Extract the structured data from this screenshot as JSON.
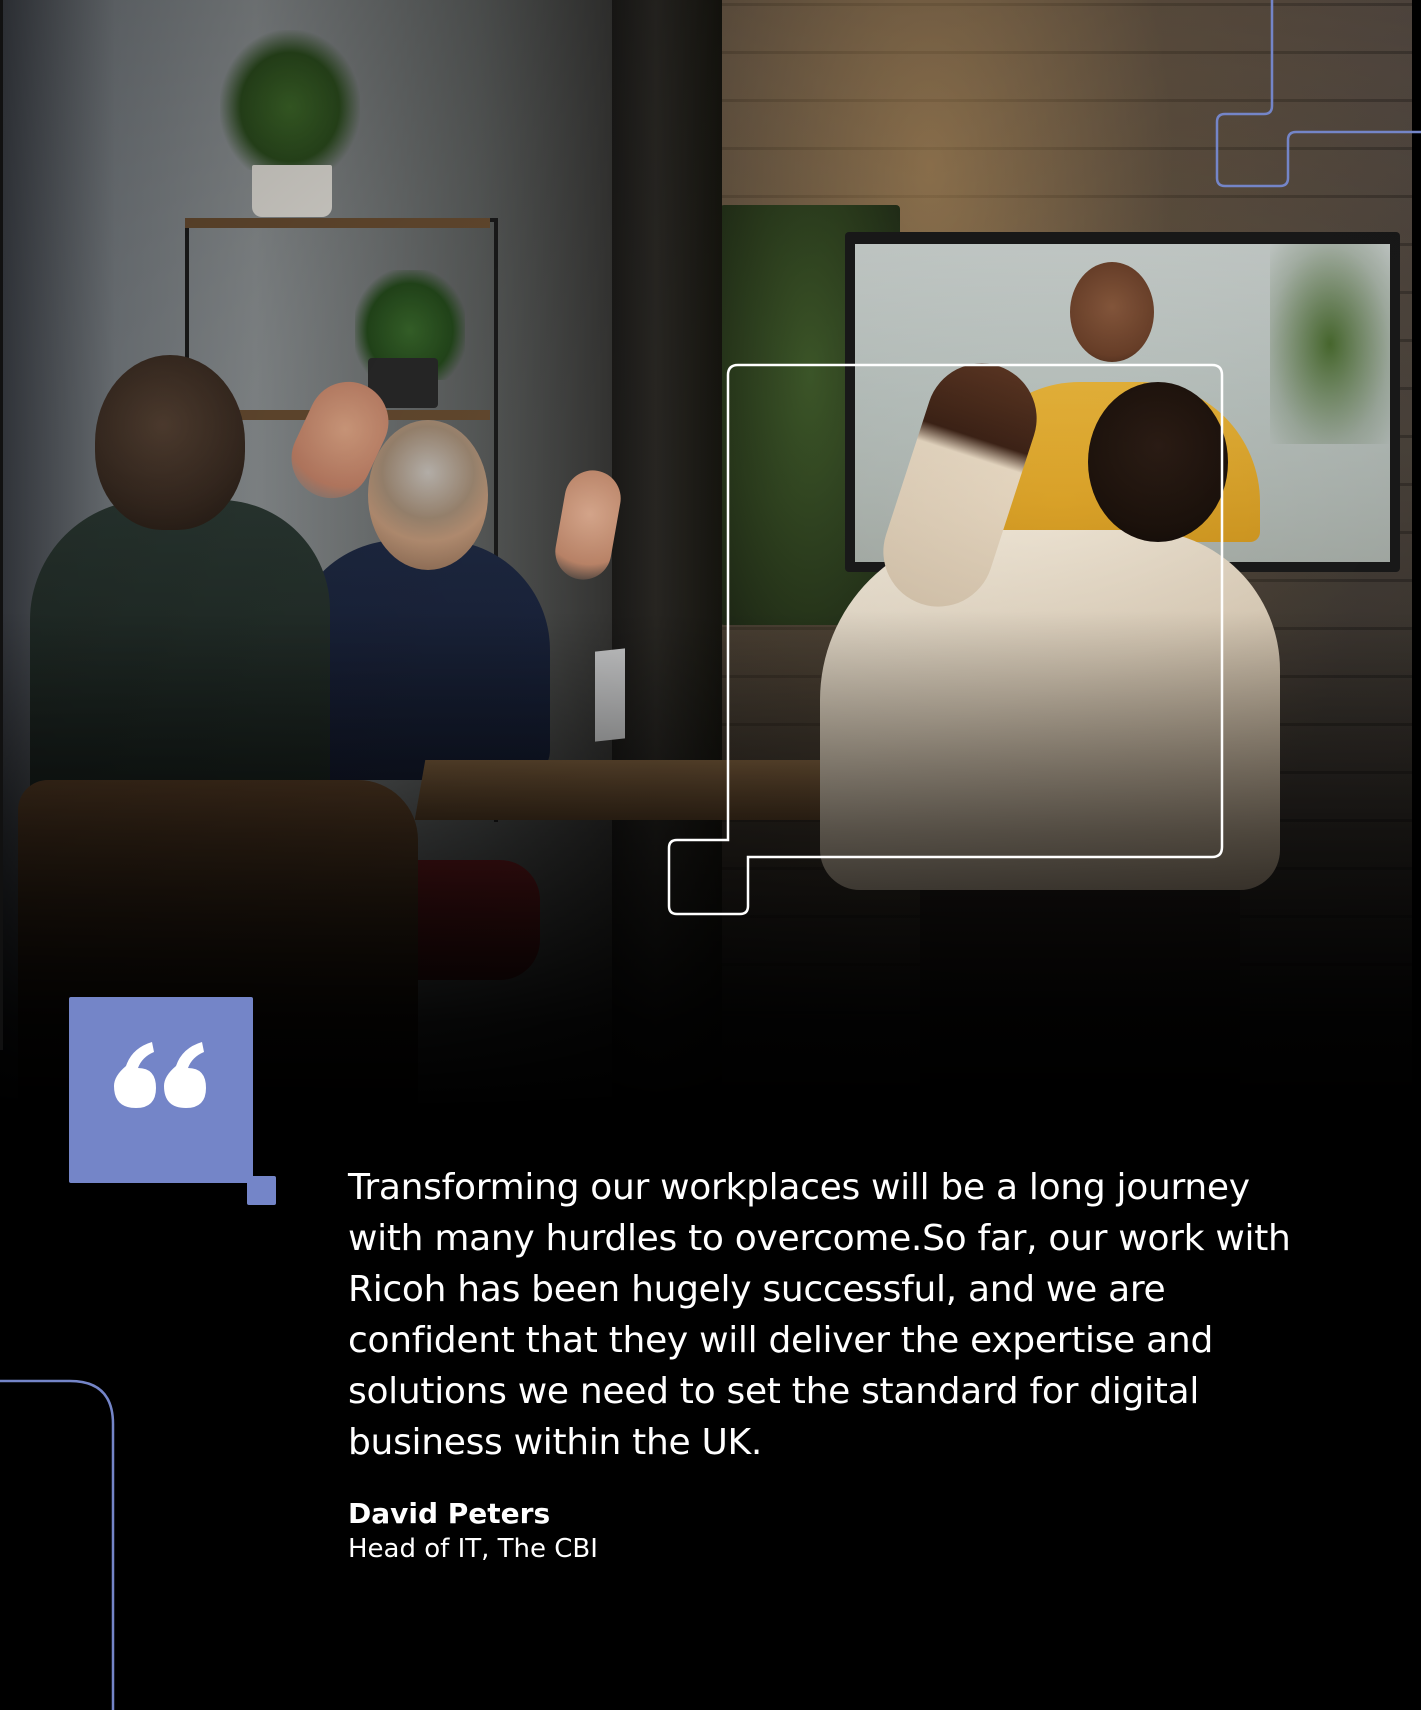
{
  "quote": {
    "text": "Transforming our workplaces will be a long journey with many hurdles to overcome.So far, our work with Ricoh has been hugely successful, and we are confident that they will deliver the expertise and solutions we need to set the standard for digital business within the UK.",
    "icon": "quote-mark-icon"
  },
  "attribution": {
    "name": "David Peters",
    "title": "Head of IT, The CBI"
  },
  "colors": {
    "background": "#000000",
    "accent": "#7485c8",
    "outline_white": "#ffffff",
    "outline_blue": "#7485c8",
    "text": "#ffffff"
  }
}
